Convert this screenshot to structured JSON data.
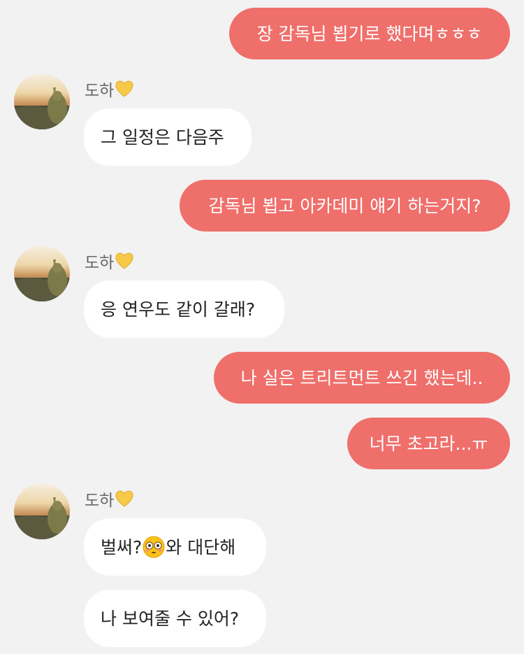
{
  "contact": {
    "name": "도하"
  },
  "messages": [
    {
      "from": "me",
      "text": "장 감독님 뵙기로 했다며ㅎㅎㅎ"
    },
    {
      "from": "them",
      "text": "그 일정은 다음주"
    },
    {
      "from": "me",
      "text": "감독님 뵙고 아카데미 얘기 하는거지?"
    },
    {
      "from": "them",
      "text": "응 연우도 같이 갈래?"
    },
    {
      "from": "me",
      "text": "나 실은 트리트먼트 쓰긴 했는데.."
    },
    {
      "from": "me",
      "text": "너무 초고라...ㅠ"
    },
    {
      "from": "them",
      "text_before": "벌써?",
      "emoji": "flushed-face",
      "text_after": "와 대단해"
    },
    {
      "from": "them",
      "text": "나 보여줄 수 있어?"
    }
  ],
  "colors": {
    "background": "#f2f2f2",
    "my_bubble": "#ef6f6b",
    "their_bubble": "#ffffff",
    "heart": "#f7c948"
  },
  "icons": {
    "sender_badge": "yellow-heart-icon",
    "avatar": "profile-photo-avatar"
  }
}
